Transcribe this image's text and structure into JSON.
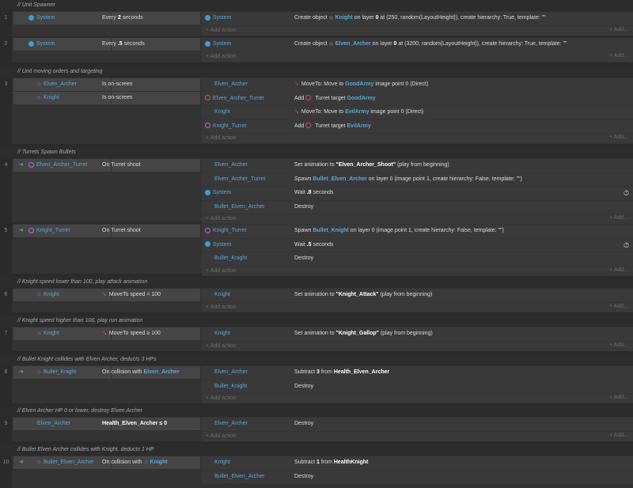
{
  "comments": {
    "c1": "//   Unit Spawner",
    "c2": "//   Unit moving orders and targeting",
    "c3": "//   Turrets Spawn Bullets",
    "c4": "//   Knight speed lower than 100, play attack animation",
    "c5": "//   Knight speed higher than 100, play run animation",
    "c6": "//   Bullet Knight collides with Elven Archer, deducts 3 HPs",
    "c7": "//   Elven Archer HP 0 or lower, destroy Elven Archer",
    "c8": "//   Bullet Elven Archer collides with Knight, deducts 1 HP"
  },
  "labels": {
    "add_action": "+ Add action",
    "add_action_short": "+ Add..."
  },
  "events": {
    "e1": {
      "num": "1",
      "c_obj": "System",
      "c_text_pre": "Every ",
      "c_text_bold": "2",
      "c_text_post": " seconds",
      "a_obj": "System",
      "a_pre": "Create object ",
      "a_hl": "Knight",
      "a_mid": " on layer ",
      "a_b": "0",
      "a_post": " at (250, random(LayoutHeight)), create hierarchy: True, template: \"\""
    },
    "e2": {
      "num": "2",
      "c_obj": "System",
      "c_text_pre": "Every ",
      "c_text_bold": ".5",
      "c_text_post": " seconds",
      "a_obj": "System",
      "a_pre": "Create object ",
      "a_hl": "Elven_Archer",
      "a_mid": " on layer ",
      "a_b": "0",
      "a_post": " at (3200, random(LayoutHeight)), create hierarchy: True, template: \"\""
    },
    "e3": {
      "num": "3",
      "c1_obj": "Elven_Archer",
      "c1_text": "Is on-screen",
      "c2_obj": "Knight",
      "c2_text": "Is on-screen",
      "a1_obj": "Elven_Archer",
      "a1_pre": "MoveTo: Move to ",
      "a1_hl": "GoodArmy",
      "a1_post": " image point 0 (Direct)",
      "a2_obj": "Elven_Archer_Turret",
      "a2_pre": "Add ",
      "a2_mid": " Turret target ",
      "a2_hl": "GoodArmy",
      "a3_obj": "Knight",
      "a3_pre": "MoveTo: Move to ",
      "a3_hl": "EvilArmy",
      "a3_post": " image point 0 (Direct)",
      "a4_obj": "Knight_Turret",
      "a4_pre": "Add ",
      "a4_mid": " Turret target ",
      "a4_hl": "EvilArmy"
    },
    "e4": {
      "num": "4",
      "c_obj": "Elven_Archer_Turret",
      "c_text": "On  Turret shoot",
      "a1_obj": "Elven_Archer",
      "a1_pre": "Set animation to ",
      "a1_b": "\"Elven_Archer_Shoot\"",
      "a1_post": " (play from beginning)",
      "a2_obj": "Elven_Archer_Turret",
      "a2_pre": "Spawn ",
      "a2_hl": "Bullet_Elven_Archer",
      "a2_post": " on layer 0 (image point 1, create hierarchy: False, template: \"\")",
      "a3_obj": "System",
      "a3_pre": "Wait ",
      "a3_b": ".8",
      "a3_post": " seconds",
      "a4_obj": "Bullet_Elven_Archer",
      "a4_text": "Destroy"
    },
    "e5": {
      "num": "5",
      "c_obj": "Knight_Turret",
      "c_text": "On  Turret shoot",
      "a1_obj": "Knight_Turret",
      "a1_pre": "Spawn ",
      "a1_hl": "Bullet_Knight",
      "a1_post": " on layer 0 (image point 1, create hierarchy: False, template: \"\")",
      "a2_obj": "System",
      "a2_pre": "Wait ",
      "a2_b": ".5",
      "a2_post": " seconds",
      "a3_obj": "Bullet_Knight",
      "a3_text": "Destroy"
    },
    "e6": {
      "num": "6",
      "c_obj": "Knight",
      "c_text": "MoveTo speed < 100",
      "a_obj": "Knight",
      "a_pre": "Set animation to ",
      "a_b": "\"Knight_Attack\"",
      "a_post": " (play from beginning)"
    },
    "e7": {
      "num": "7",
      "c_obj": "Knight",
      "c_text": "MoveTo speed ≥ 100",
      "a_obj": "Knight",
      "a_pre": "Set animation to ",
      "a_b": "\"Knight_Gallop\"",
      "a_post": " (play from beginning)"
    },
    "e8": {
      "num": "8",
      "c_obj": "Bullet_Knight",
      "c_pre": "On collision with ",
      "c_hl": "Elven_Archer",
      "a1_obj": "Elven_Archer",
      "a1_pre": "Subtract ",
      "a1_b": "3",
      "a1_mid": " from ",
      "a1_b2": "Health_Elven_Archer",
      "a2_obj": "Bullet_Knight",
      "a2_text": "Destroy"
    },
    "e9": {
      "num": "9",
      "c_obj": "Elven_Archer",
      "c_text": "Health_Elven_Archer ≤ 0",
      "a_obj": "Elven_Archer",
      "a_text": "Destroy"
    },
    "e10": {
      "num": "10",
      "c_obj": "Bullet_Elven_Archer",
      "c_pre": "On collision with ",
      "c_hl": "Knight",
      "a1_obj": "Knight",
      "a1_pre": "Subtract ",
      "a1_b": "1",
      "a1_mid": " from ",
      "a1_b2": "HealthKnight",
      "a2_obj": "Bullet_Elven_Archer",
      "a2_text": "Destroy"
    }
  }
}
